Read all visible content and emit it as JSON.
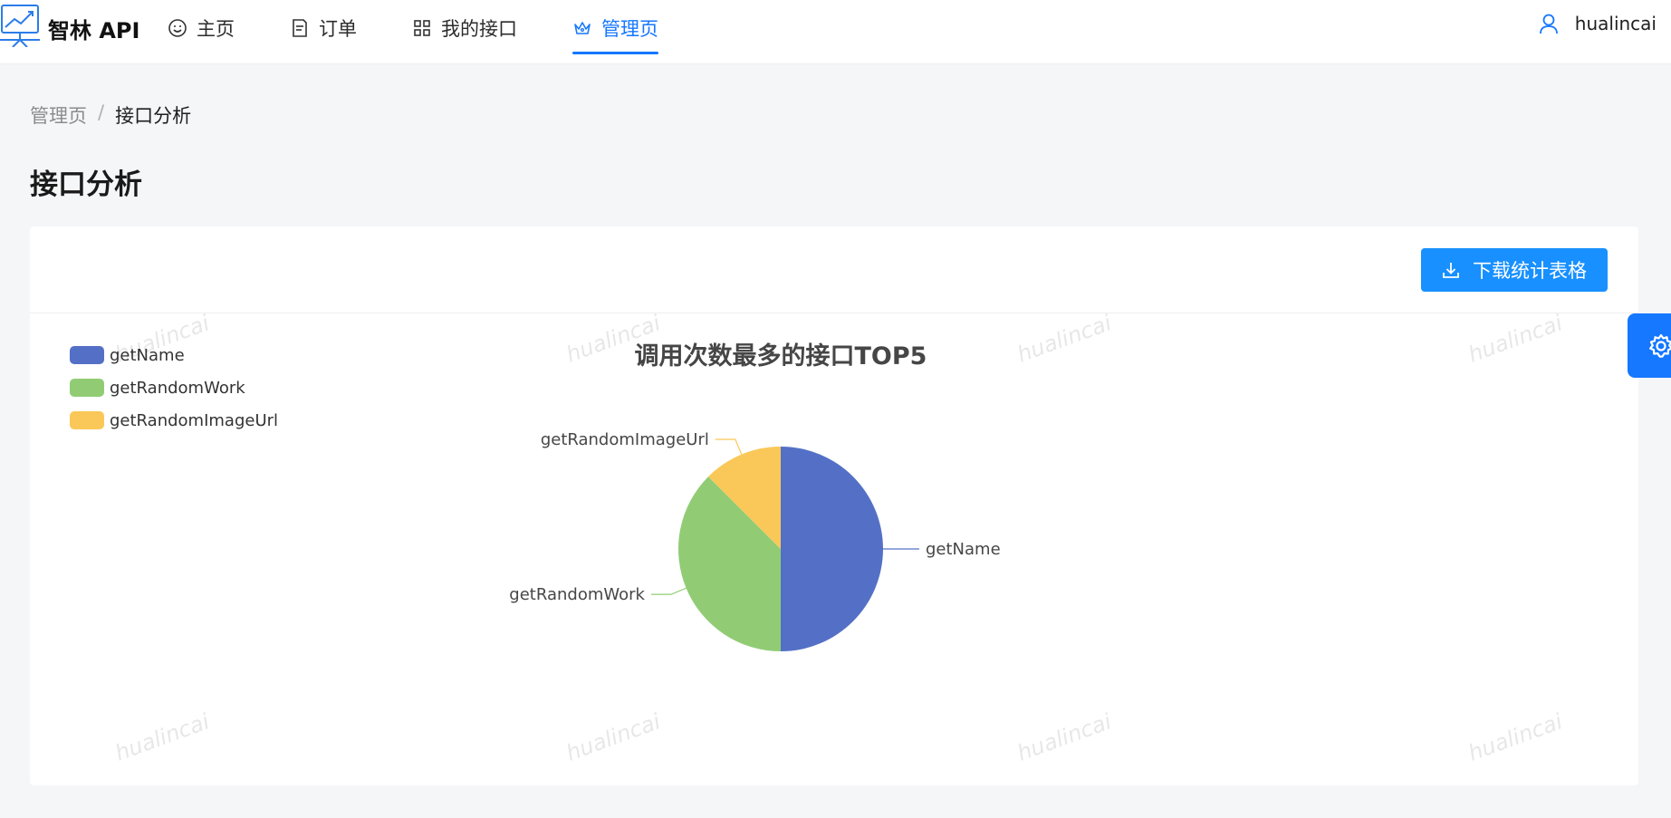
{
  "header": {
    "brand": "智林 API",
    "nav": [
      {
        "label": "主页",
        "icon": "smile-icon"
      },
      {
        "label": "订单",
        "icon": "file-text-icon"
      },
      {
        "label": "我的接口",
        "icon": "appstore-icon"
      },
      {
        "label": "管理页",
        "icon": "crown-icon",
        "active": true
      }
    ],
    "user": {
      "name": "hualincai",
      "icon": "user-icon"
    }
  },
  "breadcrumb": {
    "items": [
      "管理页",
      "接口分析"
    ],
    "separator": "/"
  },
  "page_title": "接口分析",
  "toolbar": {
    "download_label": "下载统计表格",
    "download_icon": "download-icon"
  },
  "watermark_text": "hualincai",
  "settings": {
    "icon": "gear-icon"
  },
  "colors": {
    "primary": "#1677ff",
    "button": "#1890ff"
  },
  "chart_data": {
    "type": "pie",
    "title": "调用次数最多的接口TOP5",
    "legend_position": "top-left",
    "categories": [
      "getName",
      "getRandomWork",
      "getRandomImageUrl"
    ],
    "values": [
      50,
      37.5,
      12.5
    ],
    "colors": [
      "#5470c6",
      "#91cc75",
      "#fac858"
    ]
  }
}
